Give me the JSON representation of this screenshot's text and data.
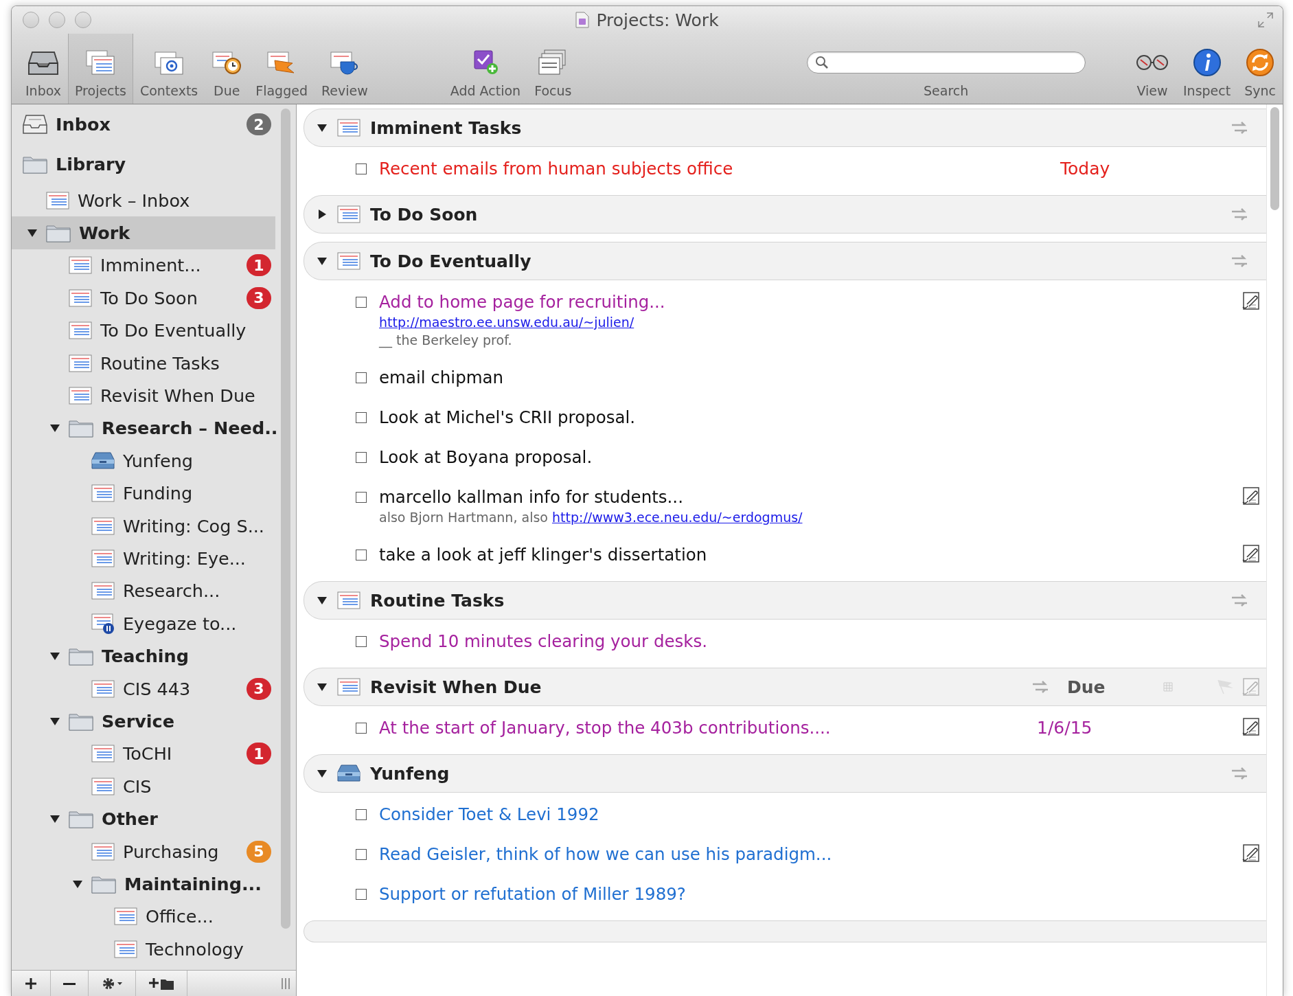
{
  "window": {
    "title": "Projects: Work"
  },
  "toolbar": {
    "left": [
      {
        "kind": "inbox",
        "label": "Inbox",
        "selected": false
      },
      {
        "kind": "projects",
        "label": "Projects",
        "selected": true
      },
      {
        "kind": "contexts",
        "label": "Contexts",
        "selected": false
      },
      {
        "kind": "due",
        "label": "Due",
        "selected": false
      },
      {
        "kind": "flagged",
        "label": "Flagged",
        "selected": false
      },
      {
        "kind": "review",
        "label": "Review",
        "selected": false
      }
    ],
    "middle": [
      {
        "kind": "add",
        "label": "Add Action",
        "selected": false
      },
      {
        "kind": "focus",
        "label": "Focus",
        "selected": false
      }
    ],
    "search": {
      "label": "Search"
    },
    "right": [
      {
        "kind": "view",
        "label": "View",
        "selected": false
      },
      {
        "kind": "inspect",
        "label": "Inspect",
        "selected": false
      },
      {
        "kind": "sync",
        "label": "Sync",
        "selected": false
      }
    ]
  },
  "sidebar": {
    "items": [
      {
        "kind": "inbox",
        "label": "Inbox",
        "selected": false,
        "badge": {
          "text": "2",
          "color": "#6e6e6e"
        }
      },
      {
        "kind": "library",
        "label": "Library",
        "selected": false,
        "children": [
          {
            "kind": "project",
            "label": "Work – Inbox",
            "selected": false
          },
          {
            "kind": "folder",
            "label": "Work",
            "selected": true,
            "expanded": true,
            "children": [
              {
                "kind": "project",
                "label": "Imminent...",
                "selected": false,
                "badge": {
                  "text": "1",
                  "color": "#d3262f"
                }
              },
              {
                "kind": "project",
                "label": "To Do Soon",
                "selected": false,
                "badge": {
                  "text": "3",
                  "color": "#d3262f"
                }
              },
              {
                "kind": "project",
                "label": "To Do Eventually",
                "selected": false
              },
              {
                "kind": "project",
                "label": "Routine Tasks",
                "selected": false
              },
              {
                "kind": "project",
                "label": "Revisit When Due",
                "selected": false
              },
              {
                "kind": "folder",
                "label": "Research – Need..",
                "selected": false,
                "expanded": true,
                "children": [
                  {
                    "kind": "context",
                    "label": "Yunfeng",
                    "selected": false
                  },
                  {
                    "kind": "project",
                    "label": "Funding",
                    "selected": false
                  },
                  {
                    "kind": "project",
                    "label": "Writing: Cog S...",
                    "selected": false
                  },
                  {
                    "kind": "project",
                    "label": "Writing: Eye...",
                    "selected": false
                  },
                  {
                    "kind": "project",
                    "label": "Research...",
                    "selected": false
                  },
                  {
                    "kind": "paused",
                    "label": "Eyegaze to...",
                    "selected": false
                  }
                ]
              },
              {
                "kind": "folder",
                "label": "Teaching",
                "selected": false,
                "expanded": true,
                "children": [
                  {
                    "kind": "project",
                    "label": "CIS 443",
                    "selected": false,
                    "badge": {
                      "text": "3",
                      "color": "#d3262f"
                    }
                  }
                ]
              },
              {
                "kind": "folder",
                "label": "Service",
                "selected": false,
                "expanded": true,
                "children": [
                  {
                    "kind": "project",
                    "label": "ToCHI",
                    "selected": false,
                    "badge": {
                      "text": "1",
                      "color": "#d3262f"
                    }
                  },
                  {
                    "kind": "project",
                    "label": "CIS",
                    "selected": false
                  }
                ]
              },
              {
                "kind": "folder",
                "label": "Other",
                "selected": false,
                "expanded": true,
                "children": [
                  {
                    "kind": "project",
                    "label": "Purchasing",
                    "selected": false,
                    "badge": {
                      "text": "5",
                      "color": "#e88a25"
                    }
                  },
                  {
                    "kind": "folder",
                    "label": "Maintaining...",
                    "selected": false,
                    "expanded": true,
                    "children": [
                      {
                        "kind": "project",
                        "label": "Office...",
                        "selected": false
                      },
                      {
                        "kind": "project",
                        "label": "Technology",
                        "selected": false
                      }
                    ]
                  }
                ]
              }
            ]
          }
        ]
      }
    ]
  },
  "groups": [
    {
      "kind": "project",
      "title": "Imminent Tasks",
      "expanded": true,
      "due_column": false,
      "tasks": [
        {
          "text": "Recent emails from human subjects office",
          "color": "#e4201c",
          "due": "Today",
          "checked": false,
          "has_note": false
        }
      ]
    },
    {
      "kind": "project",
      "title": "To Do Soon",
      "expanded": false,
      "due_column": false
    },
    {
      "kind": "project",
      "title": "To Do Eventually",
      "expanded": true,
      "due_column": false,
      "tasks": [
        {
          "text": "Add to home page for recruiting...",
          "color": "#a5219e",
          "checked": false,
          "has_note": true,
          "note": [
            {
              "link": "http://maestro.ee.unsw.edu.au/~julien/"
            },
            {
              "text": "__ the Berkeley prof."
            }
          ]
        },
        {
          "text": "email chipman",
          "color": "#111111",
          "checked": false,
          "has_note": false
        },
        {
          "text": "Look at Michel's CRII proposal.",
          "color": "#111111",
          "checked": false,
          "has_note": false
        },
        {
          "text": "Look at Boyana proposal.",
          "color": "#111111",
          "checked": false,
          "has_note": false
        },
        {
          "text": "marcello kallman info for students...",
          "color": "#111111",
          "checked": false,
          "has_note": true,
          "note": [
            {
              "text": "also Bjorn Hartmann, also ",
              "link": "http://www3.ece.neu.edu/~erdogmus/"
            }
          ]
        },
        {
          "text": "take a look at jeff klinger's dissertation",
          "color": "#111111",
          "checked": false,
          "has_note": true
        }
      ]
    },
    {
      "kind": "project",
      "title": "Routine Tasks",
      "expanded": true,
      "due_column": false,
      "tasks": [
        {
          "text": "Spend 10 minutes clearing your desks.",
          "color": "#a5219e",
          "checked": false,
          "has_note": false
        }
      ]
    },
    {
      "kind": "project",
      "title": "Revisit When Due",
      "expanded": true,
      "due_column": true,
      "due_label": "Due",
      "tasks": [
        {
          "text": "At the start of January, stop the 403b contributions....",
          "color": "#a5219e",
          "due": "1/6/15",
          "checked": false,
          "has_note": true
        }
      ]
    },
    {
      "kind": "context",
      "title": "Yunfeng",
      "expanded": true,
      "due_column": false,
      "tasks": [
        {
          "text": "Consider Toet & Levi 1992",
          "color": "#1f6fd1",
          "checked": false,
          "has_note": false
        },
        {
          "text": "Read Geisler, think of how we can use his paradigm...",
          "color": "#1f6fd1",
          "checked": false,
          "has_note": true
        },
        {
          "text": "Support or refutation of Miller 1989?",
          "color": "#1f6fd1",
          "checked": false,
          "has_note": false
        }
      ]
    }
  ]
}
